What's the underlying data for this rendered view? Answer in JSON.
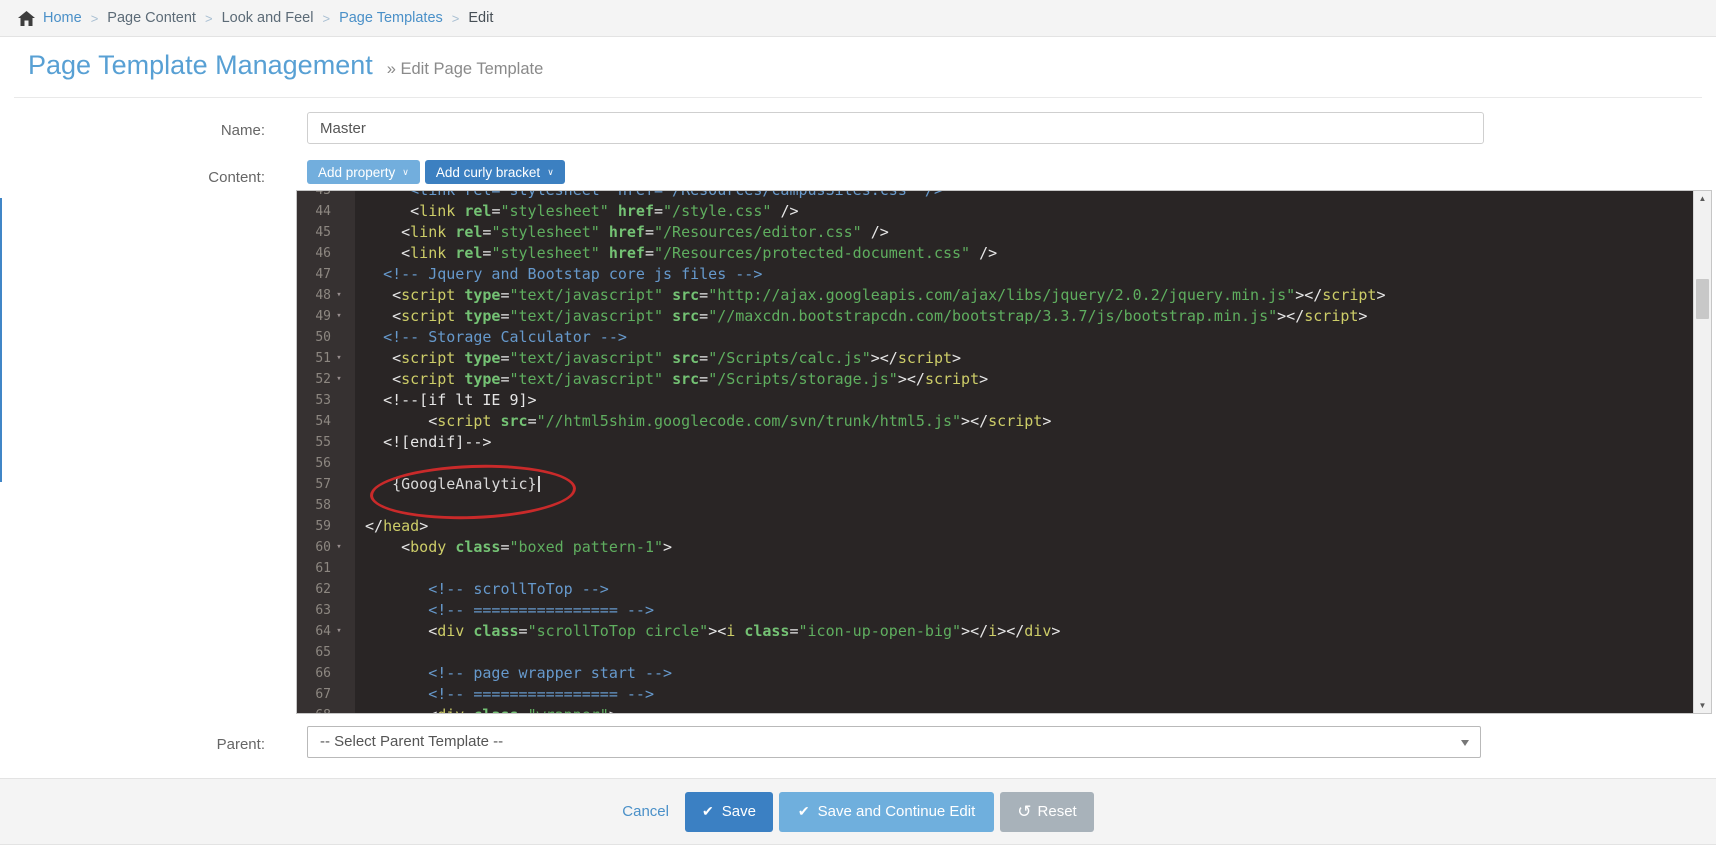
{
  "breadcrumb": {
    "separator": ">",
    "items": [
      {
        "label": "Home",
        "type": "link"
      },
      {
        "label": "Page Content",
        "type": "text"
      },
      {
        "label": "Look and Feel",
        "type": "text"
      },
      {
        "label": "Page Templates",
        "type": "link"
      },
      {
        "label": "Edit",
        "type": "current"
      }
    ]
  },
  "header": {
    "title": "Page Template Management",
    "subtitle": "» Edit Page Template"
  },
  "form": {
    "name_label": "Name:",
    "name_value": "Master",
    "content_label": "Content:",
    "add_property_label": "Add property",
    "add_curly_label": "Add curly bracket",
    "dropdown_caret": "∨",
    "parent_label": "Parent:",
    "parent_value": "-- Select Parent Template --"
  },
  "editor": {
    "colors": {
      "background": "#292525",
      "gutter": "#363131",
      "tag": "#cdcd68",
      "attribute": "#74c274",
      "string": "#5fae5f",
      "comment": "#6699cc",
      "plain": "#e6e6e6",
      "annotation_red": "#c92a2a"
    },
    "scrollbar": {
      "up_glyph": "▲",
      "down_glyph": "▼"
    },
    "fold_glyph": "▾",
    "lines": [
      {
        "num": 43,
        "indent": 5,
        "tokens": [
          [
            "c",
            "<link rel=\"stylesheet\" href=\"/Resources/campusSites.css\" />"
          ]
        ]
      },
      {
        "num": 44,
        "indent": 5,
        "tokens": [
          [
            "p",
            "<"
          ],
          [
            "t",
            "link"
          ],
          [
            "x",
            " "
          ],
          [
            "a",
            "rel"
          ],
          [
            "p",
            "="
          ],
          [
            "s",
            "\"stylesheet\""
          ],
          [
            "x",
            " "
          ],
          [
            "a",
            "href"
          ],
          [
            "p",
            "="
          ],
          [
            "s",
            "\"/style.css\""
          ],
          [
            "x",
            " "
          ],
          [
            "p",
            "/>"
          ]
        ]
      },
      {
        "num": 45,
        "indent": 4,
        "tokens": [
          [
            "p",
            "<"
          ],
          [
            "t",
            "link"
          ],
          [
            "x",
            " "
          ],
          [
            "a",
            "rel"
          ],
          [
            "p",
            "="
          ],
          [
            "s",
            "\"stylesheet\""
          ],
          [
            "x",
            " "
          ],
          [
            "a",
            "href"
          ],
          [
            "p",
            "="
          ],
          [
            "s",
            "\"/Resources/editor.css\""
          ],
          [
            "x",
            " "
          ],
          [
            "p",
            "/>"
          ]
        ]
      },
      {
        "num": 46,
        "indent": 4,
        "tokens": [
          [
            "p",
            "<"
          ],
          [
            "t",
            "link"
          ],
          [
            "x",
            " "
          ],
          [
            "a",
            "rel"
          ],
          [
            "p",
            "="
          ],
          [
            "s",
            "\"stylesheet\""
          ],
          [
            "x",
            " "
          ],
          [
            "a",
            "href"
          ],
          [
            "p",
            "="
          ],
          [
            "s",
            "\"/Resources/protected-document.css\""
          ],
          [
            "x",
            " "
          ],
          [
            "p",
            "/>"
          ]
        ]
      },
      {
        "num": 47,
        "indent": 2,
        "tokens": [
          [
            "c",
            "<!-- Jquery and Bootstap core js files -->"
          ]
        ]
      },
      {
        "num": 48,
        "indent": 3,
        "fold": true,
        "tokens": [
          [
            "p",
            "<"
          ],
          [
            "t",
            "script"
          ],
          [
            "x",
            " "
          ],
          [
            "a",
            "type"
          ],
          [
            "p",
            "="
          ],
          [
            "s",
            "\"text/javascript\""
          ],
          [
            "x",
            " "
          ],
          [
            "a",
            "src"
          ],
          [
            "p",
            "="
          ],
          [
            "s",
            "\"http://ajax.googleapis.com/ajax/libs/jquery/2.0.2/jquery.min.js\""
          ],
          [
            "p",
            "></"
          ],
          [
            "t",
            "script"
          ],
          [
            "p",
            ">"
          ]
        ]
      },
      {
        "num": 49,
        "indent": 3,
        "fold": true,
        "tokens": [
          [
            "p",
            "<"
          ],
          [
            "t",
            "script"
          ],
          [
            "x",
            " "
          ],
          [
            "a",
            "type"
          ],
          [
            "p",
            "="
          ],
          [
            "s",
            "\"text/javascript\""
          ],
          [
            "x",
            " "
          ],
          [
            "a",
            "src"
          ],
          [
            "p",
            "="
          ],
          [
            "s",
            "\"//maxcdn.bootstrapcdn.com/bootstrap/3.3.7/js/bootstrap.min.js\""
          ],
          [
            "p",
            "></"
          ],
          [
            "t",
            "script"
          ],
          [
            "p",
            ">"
          ]
        ]
      },
      {
        "num": 50,
        "indent": 2,
        "tokens": [
          [
            "c",
            "<!-- Storage Calculator -->"
          ]
        ]
      },
      {
        "num": 51,
        "indent": 3,
        "fold": true,
        "tokens": [
          [
            "p",
            "<"
          ],
          [
            "t",
            "script"
          ],
          [
            "x",
            " "
          ],
          [
            "a",
            "type"
          ],
          [
            "p",
            "="
          ],
          [
            "s",
            "\"text/javascript\""
          ],
          [
            "x",
            " "
          ],
          [
            "a",
            "src"
          ],
          [
            "p",
            "="
          ],
          [
            "s",
            "\"/Scripts/calc.js\""
          ],
          [
            "p",
            "></"
          ],
          [
            "t",
            "script"
          ],
          [
            "p",
            ">"
          ]
        ]
      },
      {
        "num": 52,
        "indent": 3,
        "fold": true,
        "tokens": [
          [
            "p",
            "<"
          ],
          [
            "t",
            "script"
          ],
          [
            "x",
            " "
          ],
          [
            "a",
            "type"
          ],
          [
            "p",
            "="
          ],
          [
            "s",
            "\"text/javascript\""
          ],
          [
            "x",
            " "
          ],
          [
            "a",
            "src"
          ],
          [
            "p",
            "="
          ],
          [
            "s",
            "\"/Scripts/storage.js\""
          ],
          [
            "p",
            "></"
          ],
          [
            "t",
            "script"
          ],
          [
            "p",
            ">"
          ]
        ]
      },
      {
        "num": 53,
        "indent": 2,
        "tokens": [
          [
            "p",
            "<!--[if lt IE 9]>"
          ]
        ]
      },
      {
        "num": 54,
        "indent": 7,
        "tokens": [
          [
            "p",
            "<"
          ],
          [
            "t",
            "script"
          ],
          [
            "x",
            " "
          ],
          [
            "a",
            "src"
          ],
          [
            "p",
            "="
          ],
          [
            "s",
            "\"//html5shim.googlecode.com/svn/trunk/html5.js\""
          ],
          [
            "p",
            "></"
          ],
          [
            "t",
            "script"
          ],
          [
            "p",
            ">"
          ]
        ]
      },
      {
        "num": 55,
        "indent": 2,
        "tokens": [
          [
            "p",
            "<![endif]-->"
          ]
        ]
      },
      {
        "num": 56,
        "indent": 0,
        "tokens": []
      },
      {
        "num": 57,
        "indent": 3,
        "cursor": true,
        "tokens": [
          [
            "x",
            "{GoogleAnalytic}"
          ]
        ]
      },
      {
        "num": 58,
        "indent": 0,
        "tokens": []
      },
      {
        "num": 59,
        "indent": 0,
        "tokens": [
          [
            "p",
            "</"
          ],
          [
            "t",
            "head"
          ],
          [
            "p",
            ">"
          ]
        ]
      },
      {
        "num": 60,
        "indent": 4,
        "fold": true,
        "tokens": [
          [
            "p",
            "<"
          ],
          [
            "t",
            "body"
          ],
          [
            "x",
            " "
          ],
          [
            "a",
            "class"
          ],
          [
            "p",
            "="
          ],
          [
            "s",
            "\"boxed pattern-1\""
          ],
          [
            "p",
            ">"
          ]
        ]
      },
      {
        "num": 61,
        "indent": 0,
        "tokens": []
      },
      {
        "num": 62,
        "indent": 7,
        "tokens": [
          [
            "c",
            "<!-- scrollToTop -->"
          ]
        ]
      },
      {
        "num": 63,
        "indent": 7,
        "tokens": [
          [
            "c",
            "<!-- ================ -->"
          ]
        ]
      },
      {
        "num": 64,
        "indent": 7,
        "fold": true,
        "tokens": [
          [
            "p",
            "<"
          ],
          [
            "t",
            "div"
          ],
          [
            "x",
            " "
          ],
          [
            "a",
            "class"
          ],
          [
            "p",
            "="
          ],
          [
            "s",
            "\"scrollToTop circle\""
          ],
          [
            "p",
            "><"
          ],
          [
            "t",
            "i"
          ],
          [
            "x",
            " "
          ],
          [
            "a",
            "class"
          ],
          [
            "p",
            "="
          ],
          [
            "s",
            "\"icon-up-open-big\""
          ],
          [
            "p",
            "></"
          ],
          [
            "t",
            "i"
          ],
          [
            "p",
            "></"
          ],
          [
            "t",
            "div"
          ],
          [
            "p",
            ">"
          ]
        ]
      },
      {
        "num": 65,
        "indent": 0,
        "tokens": []
      },
      {
        "num": 66,
        "indent": 7,
        "tokens": [
          [
            "c",
            "<!-- page wrapper start -->"
          ]
        ]
      },
      {
        "num": 67,
        "indent": 7,
        "tokens": [
          [
            "c",
            "<!-- ================ -->"
          ]
        ]
      },
      {
        "num": 68,
        "indent": 7,
        "tokens": [
          [
            "p",
            "<"
          ],
          [
            "t",
            "div"
          ],
          [
            "x",
            " "
          ],
          [
            "a",
            "class"
          ],
          [
            "p",
            "="
          ],
          [
            "s",
            "\"wrapper\""
          ],
          [
            "p",
            ">"
          ]
        ]
      }
    ]
  },
  "footer": {
    "cancel_label": "Cancel",
    "save_label": "Save",
    "save_continue_label": "Save and Continue Edit",
    "reset_label": "Reset",
    "check_icon": "✔",
    "reset_icon": "↺"
  }
}
